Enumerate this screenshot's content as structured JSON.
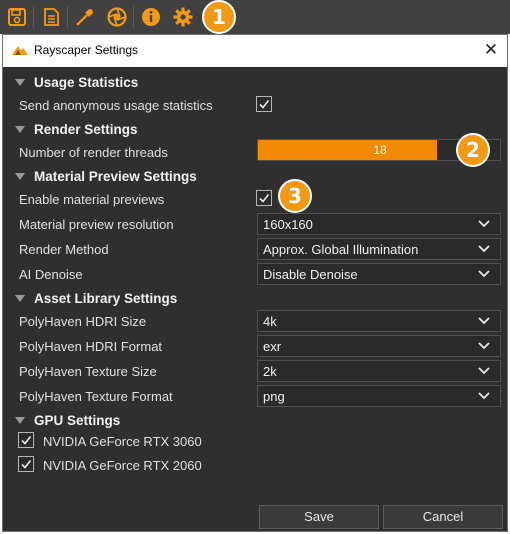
{
  "toolbar": {
    "icons": [
      "save-icon",
      "document-icon",
      "eyedropper-icon",
      "aperture-icon",
      "info-icon",
      "gear-icon"
    ],
    "accent": "#f39a12"
  },
  "annotations": [
    "1",
    "2",
    "3"
  ],
  "dialog": {
    "title": "Rayscaper Settings",
    "close_glyph": "✕",
    "sections": {
      "usage": {
        "title": "Usage Statistics",
        "send_stats": {
          "label": "Send anonymous usage statistics",
          "checked": true
        }
      },
      "render": {
        "title": "Render Settings",
        "threads": {
          "label": "Number of render threads",
          "value": "18",
          "fill_fraction": 0.74
        }
      },
      "material": {
        "title": "Material Preview Settings",
        "enable": {
          "label": "Enable material previews",
          "checked": true
        },
        "resolution": {
          "label": "Material preview resolution",
          "value": "160x160"
        },
        "method": {
          "label": "Render Method",
          "value": "Approx. Global Illumination"
        },
        "denoise": {
          "label": "AI Denoise",
          "value": "Disable Denoise"
        }
      },
      "asset": {
        "title": "Asset Library Settings",
        "hdri_size": {
          "label": "PolyHaven HDRI Size",
          "value": "4k"
        },
        "hdri_format": {
          "label": "PolyHaven HDRI Format",
          "value": "exr"
        },
        "texture_size": {
          "label": "PolyHaven Texture Size",
          "value": "2k"
        },
        "texture_format": {
          "label": "PolyHaven Texture Format",
          "value": "png"
        }
      },
      "gpu": {
        "title": "GPU Settings",
        "gpus": [
          {
            "label": "NVIDIA GeForce RTX 3060",
            "checked": true
          },
          {
            "label": "NVIDIA GeForce RTX 2060",
            "checked": true
          }
        ]
      }
    },
    "buttons": {
      "save": "Save",
      "cancel": "Cancel"
    }
  }
}
